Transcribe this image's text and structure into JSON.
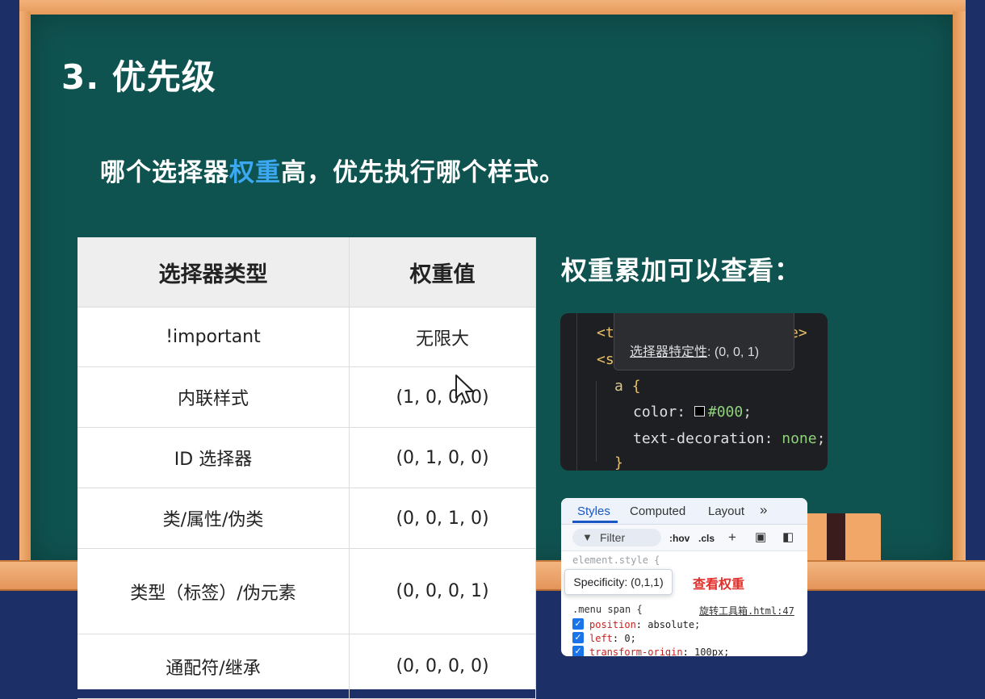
{
  "title": "3. 优先级",
  "subtitle": {
    "before": "哪个选择器",
    "highlight": "权重",
    "after": "高，优先执行哪个样式。"
  },
  "table": {
    "headers": [
      "选择器类型",
      "权重值"
    ],
    "rows": [
      [
        "!important",
        "无限大"
      ],
      [
        "内联样式",
        "(1, 0, 0, 0)"
      ],
      [
        "ID 选择器",
        "(0, 1, 0, 0)"
      ],
      [
        "类/属性/伪类",
        "(0, 0, 1, 0)"
      ],
      [
        "类型（标签）/伪元素",
        "(0, 0, 0, 1)"
      ],
      [
        "通配符/继承",
        "(0, 0, 0, 0)"
      ]
    ]
  },
  "right_heading": "权重累加可以查看：",
  "code_panel": {
    "line1_open": "<t",
    "line1_close": "e>",
    "line2_open": "<s",
    "line3_selector": "a",
    "line3_brace": "{",
    "line4_prop": "color",
    "line4_val": "#000",
    "line5_prop": "text-decoration",
    "line5_val": "none",
    "line6_brace": "}",
    "popup_label": "选择器特定性",
    "popup_value": ": (0, 0, 1)"
  },
  "devtools": {
    "tabs": [
      "Styles",
      "Computed",
      "Layout",
      "»"
    ],
    "filter_placeholder": "Filter",
    "hov": ":hov",
    "cls": ".cls",
    "element_style": "element.style {",
    "tooltip": "Specificity: (0,1,1)",
    "note": "查看权重",
    "rule_selector": ".menu span {",
    "rule_source": "旋转工具箱.html:47",
    "properties": [
      {
        "name": "position",
        "value": "absolute;"
      },
      {
        "name": "left",
        "value": "0;"
      },
      {
        "name": "transform-origin",
        "value": "100px;"
      }
    ]
  }
}
